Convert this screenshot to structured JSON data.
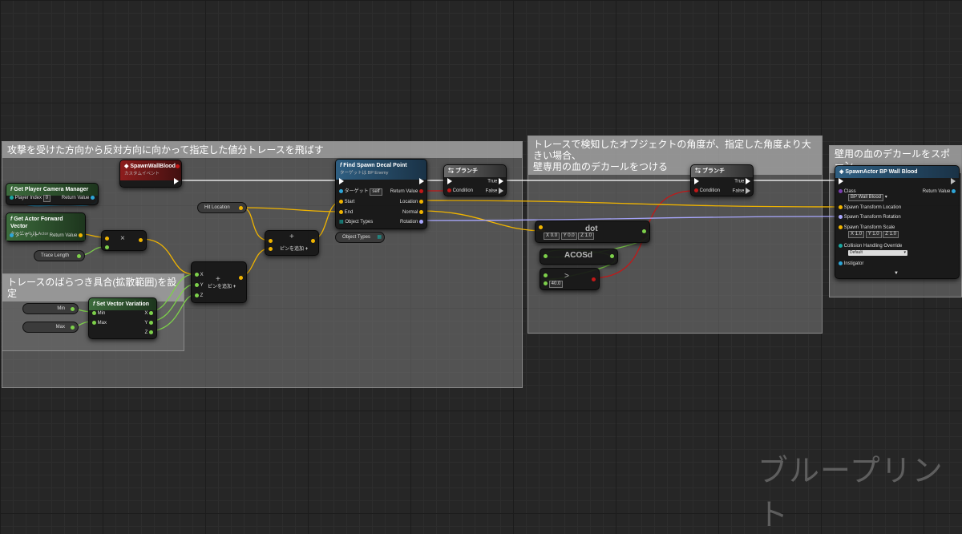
{
  "comments": {
    "main": "攻撃を受けた方向から反対方向に向かって指定した値分トレースを飛ばす",
    "variation": "トレースのばらつき具合(拡散範囲)を設定",
    "angle": "トレースで検知したオブジェクトの角度が、指定した角度より大きい場合、\n壁専用の血のデカールをつける",
    "spawn": "壁用の血のデカールをスポーン"
  },
  "nodes": {
    "spawn_wall_blood": {
      "title": "SpawnWallBlood",
      "subtitle": "カスタムイベント"
    },
    "get_camera_manager": {
      "title": "Get Player Camera Manager",
      "player_index_label": "Player Index",
      "player_index_value": "0",
      "return_label": "Return Value"
    },
    "get_forward_vector": {
      "title": "Get Actor Forward Vector",
      "subtitle": "ターゲットは Actor",
      "target_label": "ターゲット",
      "return_label": "Return Value"
    },
    "trace_length": {
      "label": "Trace Length"
    },
    "multiply": {
      "symbol": "×"
    },
    "hit_location": {
      "label": "Hit Location"
    },
    "add_1": {
      "symbol": "+",
      "add_pin": "ピンを追加"
    },
    "make_vector": {
      "symbol": "+",
      "add_pin": "ピンを追加",
      "x": "X",
      "y": "Y",
      "z": "Z"
    },
    "set_vector_variation": {
      "title": "Set Vector Variation",
      "min_label": "Min",
      "max_label": "Max",
      "x": "X",
      "y": "Y",
      "z": "Z"
    },
    "min_var": {
      "label": "Min"
    },
    "max_var": {
      "label": "Max"
    },
    "find_spawn": {
      "title": "Find Spawn Decal Point",
      "subtitle": "ターゲットは BP Enemy",
      "target_label": "ターゲット",
      "target_value": "self",
      "start": "Start",
      "end": "End",
      "object_types": "Object Types",
      "return_value": "Return Value",
      "location": "Location",
      "normal": "Normal",
      "rotation": "Rotation"
    },
    "object_types_var": {
      "label": "Object Types"
    },
    "branch_1": {
      "title": "ブランチ",
      "condition": "Condition",
      "true_label": "True",
      "false_label": "False"
    },
    "branch_2": {
      "title": "ブランチ",
      "condition": "Condition",
      "true_label": "True",
      "false_label": "False"
    },
    "dot": {
      "label": "dot",
      "x": "X",
      "x_val": "0.0",
      "y": "Y",
      "y_val": "0.0",
      "z": "Z",
      "z_val": "1.0"
    },
    "acosd": {
      "label": "ACOSd"
    },
    "greater": {
      "symbol": ">",
      "value": "40.0"
    },
    "spawn_actor": {
      "title": "SpawnActor BP Wall Blood",
      "class_label": "Class",
      "class_value": "BP Wall Blood",
      "return_label": "Return Value",
      "location": "Spawn Transform Location",
      "rotation": "Spawn Transform Rotation",
      "scale": "Spawn Transform Scale",
      "sx": "X",
      "sx_val": "1.0",
      "sy": "Y",
      "sy_val": "1.0",
      "sz": "Z",
      "sz_val": "1.0",
      "collision": "Collision Handling Override",
      "collision_value": "Default",
      "instigator": "Instigator"
    }
  },
  "watermark": "ブループリント",
  "colors": {
    "exec": "#ffffff",
    "vector": "#f0b400",
    "float": "#7dd04a",
    "object": "#2ea6d8",
    "bool": "#c21818",
    "rotator": "#a9a8ff"
  }
}
